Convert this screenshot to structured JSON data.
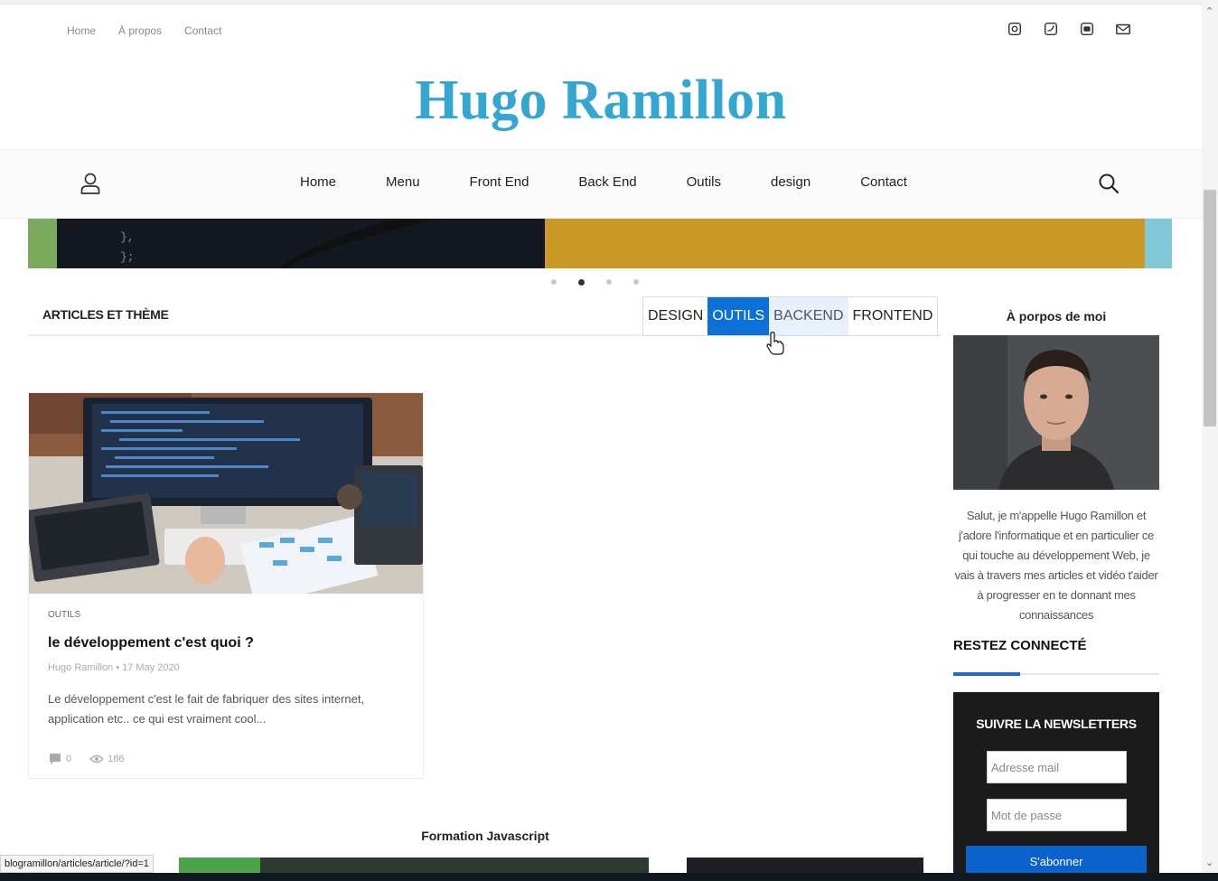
{
  "top_links": [
    "Home",
    "À propos",
    "Contact"
  ],
  "socials": [
    "instagram-icon",
    "twitter-icon",
    "youtube-icon",
    "mail-icon"
  ],
  "site_title": "Hugo Ramillon",
  "nav": {
    "items": [
      "Home",
      "Menu",
      "Front End",
      "Back End",
      "Outils",
      "design",
      "Contact"
    ]
  },
  "slider": {
    "code_lines": [
      "},",
      "};"
    ],
    "dots": 4,
    "active_dot": 1
  },
  "articles": {
    "section_title": "ARTICLES ET THÈME",
    "tabs": [
      "DESIGN",
      "OUTILS",
      "BACKEND",
      "FRONTEND"
    ],
    "active_tab": "OUTILS",
    "hover_tab": "BACKEND"
  },
  "card": {
    "category": "OUTILS",
    "title": "le développement c'est quoi ?",
    "author": "Hugo Ramillon",
    "date": "17 May 2020",
    "excerpt": "Le développement c'est le fait de fabriquer des sites internet, application etc.. ce qui est vraiment cool...",
    "comments": "0",
    "views": "186"
  },
  "formation_title": "Formation Javascript",
  "sidebar": {
    "about_title": "À porpos de moi",
    "about_text": "Salut, je m'appelle Hugo Ramillon et j'adore l'informatique et en particulier ce qui touche au développement Web, je vais à travers mes articles et vidéo t'aider à progresser en te donnant mes connaissances",
    "stay_title": "RESTEZ CONNECTÉ",
    "newsletter_title": "SUIVRE LA NEWSLETTERS",
    "email_placeholder": "Adresse mail",
    "password_placeholder": "Mot de passe",
    "subscribe_label": "S'abonner"
  },
  "status_url": "blogramillon/articles/article/?id=1",
  "colors": {
    "brand": "#34a6cf",
    "accent": "#0b71d9"
  }
}
